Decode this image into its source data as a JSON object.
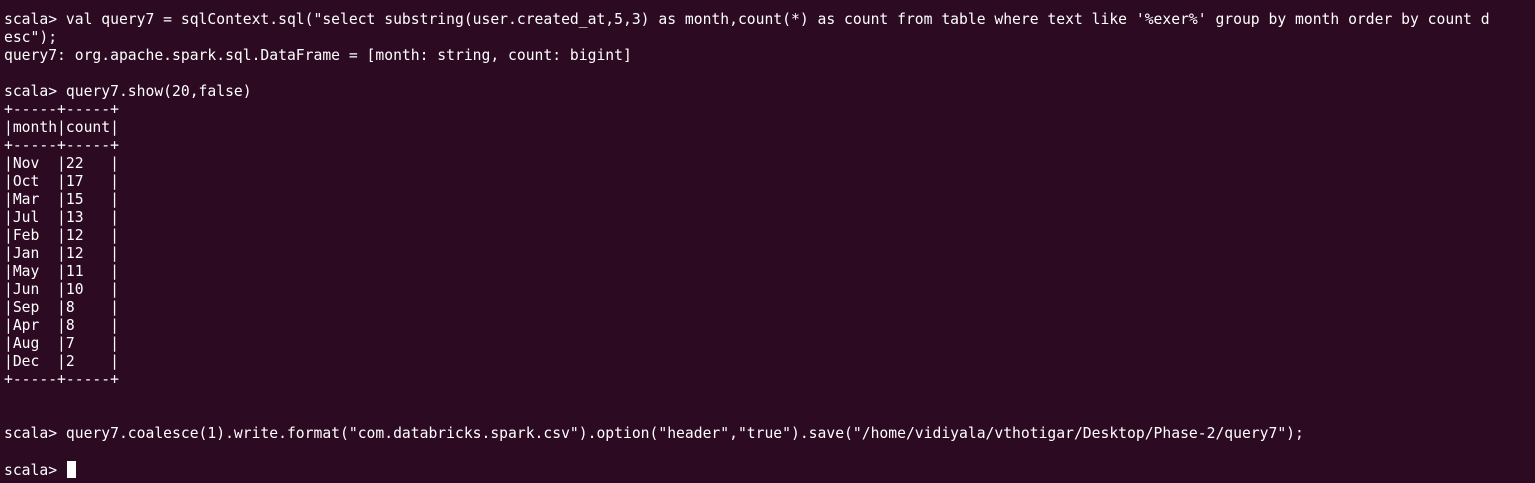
{
  "terminal": {
    "lines": [
      "scala> val query7 = sqlContext.sql(\"select substring(user.created_at,5,3) as month,count(*) as count from table where text like '%exer%' group by month order by count d",
      "esc\");",
      "query7: org.apache.spark.sql.DataFrame = [month: string, count: bigint]",
      "",
      "scala> query7.show(20,false)",
      "+-----+-----+",
      "|month|count|",
      "+-----+-----+",
      "|Nov  |22   |",
      "|Oct  |17   |",
      "|Mar  |15   |",
      "|Jul  |13   |",
      "|Feb  |12   |",
      "|Jan  |12   |",
      "|May  |11   |",
      "|Jun  |10   |",
      "|Sep  |8    |",
      "|Apr  |8    |",
      "|Aug  |7    |",
      "|Dec  |2    |",
      "+-----+-----+",
      "",
      "",
      "scala> query7.coalesce(1).write.format(\"com.databricks.spark.csv\").option(\"header\",\"true\").save(\"/home/vidiyala/vthotigar/Desktop/Phase-2/query7\");",
      ""
    ],
    "prompt": "scala> ",
    "colors": {
      "background": "#2c0a22",
      "foreground": "#ffffff"
    }
  }
}
